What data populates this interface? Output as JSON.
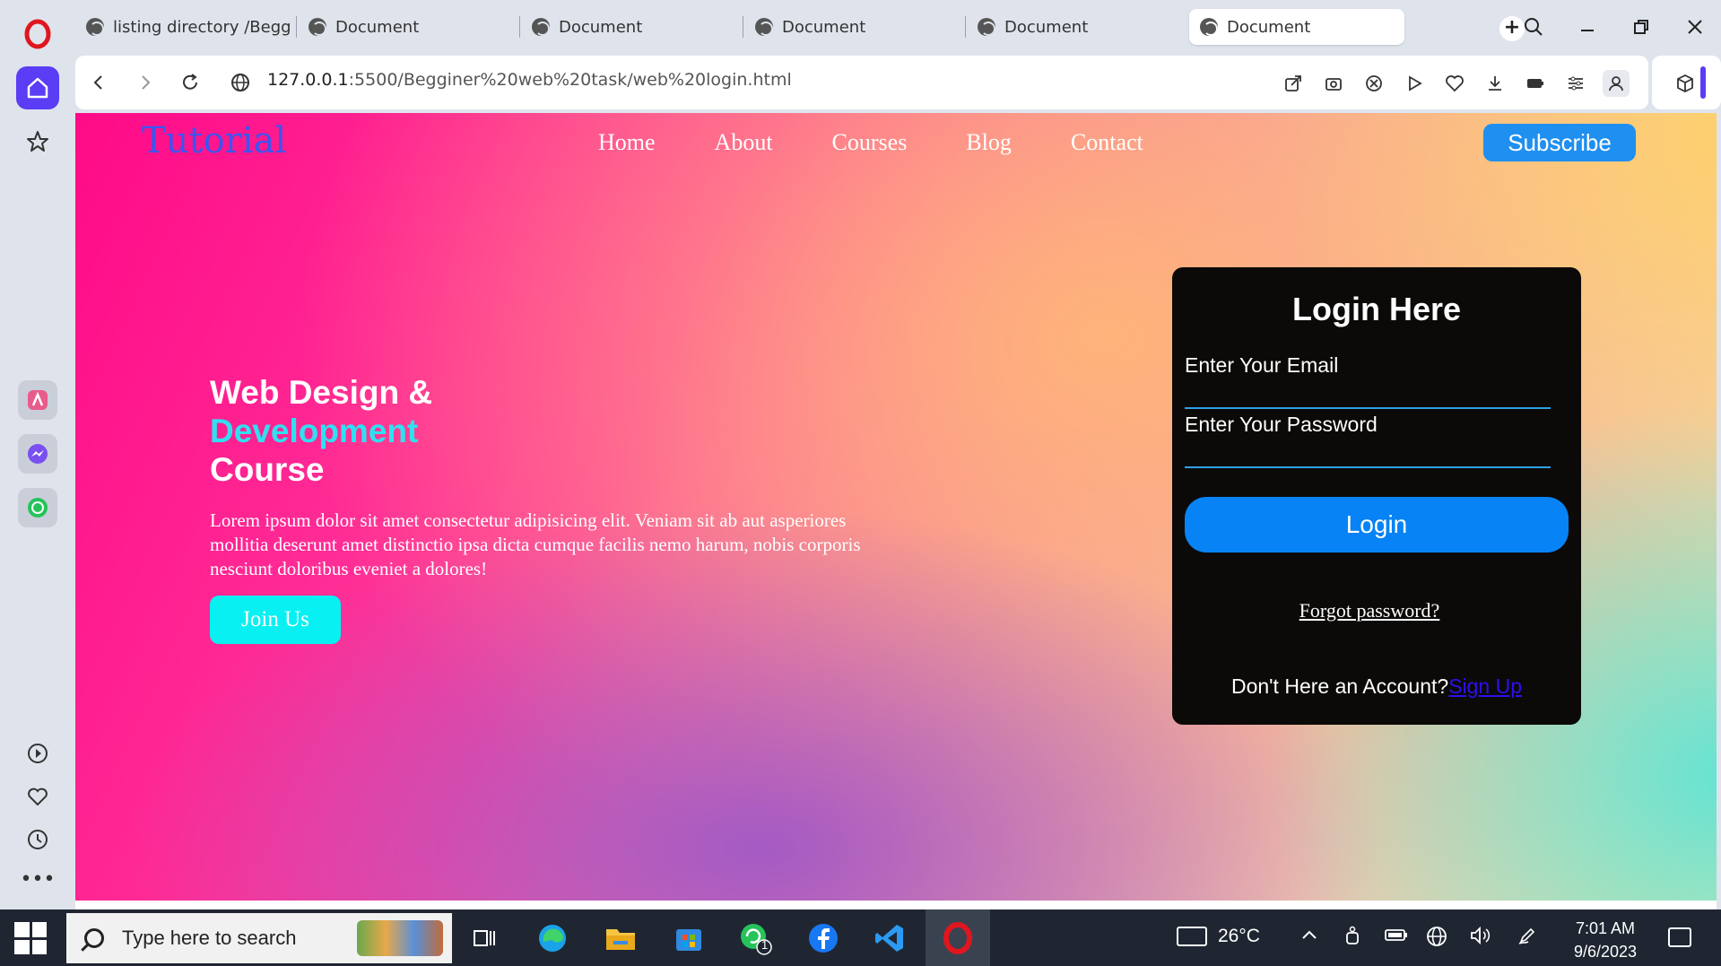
{
  "browser": {
    "tabs": [
      {
        "label": "listing directory /Begginer"
      },
      {
        "label": "Document"
      },
      {
        "label": "Document"
      },
      {
        "label": "Document"
      },
      {
        "label": "Document"
      },
      {
        "label": "Document"
      }
    ],
    "active_tab_index": 5,
    "new_tab_label": "+",
    "url_host": "127.0.0.1",
    "url_path": ":5500/Begginer%20web%20task/web%20login.html",
    "icons": {
      "back": "chevron-left-icon",
      "forward": "chevron-right-icon",
      "reload": "reload-icon",
      "site_info": "globe-icon",
      "share": "share-icon",
      "snapshot": "camera-icon",
      "adblock": "block-icon",
      "player": "play-icon",
      "heart": "heart-icon",
      "download": "download-icon",
      "battery": "battery-icon",
      "easy_setup": "settings-sliders-icon",
      "profile": "profile-icon",
      "extensions": "cube-icon"
    },
    "sidebar_icons": [
      "opera-logo-icon",
      "home-icon",
      "star-icon",
      "aria-icon",
      "messenger-icon",
      "whatsapp-icon",
      "player-icon",
      "heart-icon",
      "history-icon",
      "more-icon"
    ]
  },
  "nav": {
    "logo": "Tutorial",
    "links": [
      "Home",
      "About",
      "Courses",
      "Blog",
      "Contact"
    ],
    "subscribe": "Subscribe"
  },
  "hero": {
    "line1": "Web Design &",
    "line2": "Development",
    "line3": "Course",
    "paragraph": "Lorem ipsum dolor sit amet consectetur adipisicing elit. Veniam sit ab aut asperiores mollitia deserunt amet distinctio ipsa dicta cumque facilis nemo harum, nobis corporis nesciunt doloribus eveniet a dolores!",
    "cta": "Join Us",
    "accent_color": "#30e0f0"
  },
  "login": {
    "title": "Login Here",
    "email_label": "Enter Your Email",
    "password_label": "Enter Your Password",
    "button": "Login",
    "forgot": "Forgot password?",
    "no_account": "Don't Here an Account?",
    "signup": "Sign Up",
    "button_color": "#0783f5"
  },
  "taskbar": {
    "search_placeholder": "Type here to search",
    "apps": [
      "task-view-icon",
      "edge-icon",
      "file-explorer-icon",
      "store-icon",
      "whatsapp-icon",
      "facebook-icon",
      "vscode-icon",
      "opera-icon"
    ],
    "whatsapp_badge": "1",
    "temperature": "26°C",
    "time": "7:01 AM",
    "date": "9/6/2023"
  }
}
